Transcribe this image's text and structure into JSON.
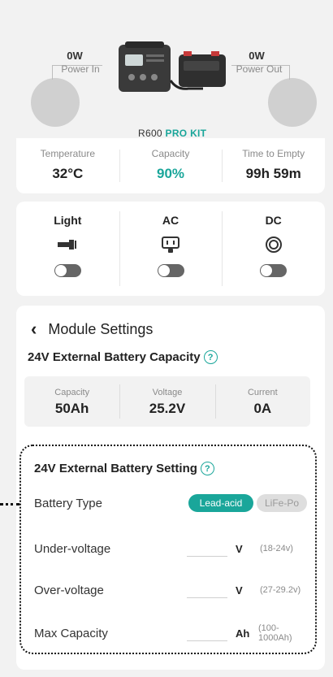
{
  "power": {
    "in_value": "0W",
    "in_label": "Power In",
    "out_value": "0W",
    "out_label": "Power Out",
    "model_prefix": "R600",
    "model_suffix": "PRO KIT"
  },
  "stats": [
    {
      "label": "Temperature",
      "value": "32°C"
    },
    {
      "label": "Capacity",
      "value": "90%"
    },
    {
      "label": "Time to Empty",
      "value": "99h 59m"
    }
  ],
  "outputs": [
    {
      "label": "Light",
      "icon": "flashlight-icon",
      "state": "off"
    },
    {
      "label": "AC",
      "icon": "ac-outlet-icon",
      "state": "off"
    },
    {
      "label": "DC",
      "icon": "dc-port-icon",
      "state": "off"
    }
  ],
  "module": {
    "back_icon": "chevron-left-icon",
    "title": "Module Settings",
    "capacity_title": "24V External Battery Capacity",
    "stats": [
      {
        "label": "Capacity",
        "value": "50Ah"
      },
      {
        "label": "Voltage",
        "value": "25.2V"
      },
      {
        "label": "Current",
        "value": "0A"
      }
    ],
    "setting_title": "24V External Battery Setting",
    "battery_type_label": "Battery Type",
    "battery_type_options": [
      "Lead-acid",
      "LiFe-Po"
    ],
    "battery_type_selected": "Lead-acid",
    "under_voltage": {
      "label": "Under-voltage",
      "value": "",
      "unit": "V",
      "range": "(18-24v)"
    },
    "over_voltage": {
      "label": "Over-voltage",
      "value": "",
      "unit": "V",
      "range": "(27-29.2v)"
    },
    "max_capacity": {
      "label": "Max Capacity",
      "value": "",
      "unit": "Ah",
      "range": "(100-1000Ah)"
    }
  },
  "colors": {
    "accent": "#1aa69a",
    "toggle_off": "#666666",
    "background": "#f2f2f2"
  }
}
